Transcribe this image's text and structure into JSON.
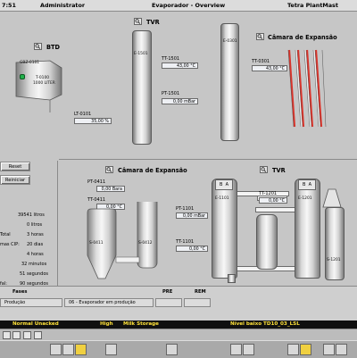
{
  "titlebar": {
    "time": "7:51",
    "user": "Administrator",
    "screen": "Evaporador - Overview",
    "app": "Tetra PlantMast"
  },
  "btd": {
    "title": "BTD",
    "tank_id": "GBZ-0101",
    "tank_label": "T-0100",
    "tank_volume": "1000 LITER",
    "lt_tag": "LT-0101",
    "lt_value": "35,00 %"
  },
  "tvr_top": {
    "title": "TVR",
    "vessel_label": "E-1501",
    "tt_tag": "TT-1501",
    "tt_value": "43,00 °C",
    "pt_tag": "PT-1501",
    "pt_value": "0,00 mBar"
  },
  "flash_top": {
    "title": "Câmara de Expansão",
    "vessel_label": "E-0301",
    "tt_tag": "TT-0301",
    "tt_value": "43,00 °C"
  },
  "side": {
    "reset_label": "Reset",
    "reiniciar_label": "Reiniciar",
    "stats": [
      {
        "label": "",
        "value": "39541 litros"
      },
      {
        "label": "",
        "value": "0 litros"
      },
      {
        "label": "Total",
        "value": "3 horas"
      },
      {
        "label": "mas CIP:",
        "value": "20 dias"
      },
      {
        "label": "",
        "value": "4 horas"
      },
      {
        "label": "",
        "value": "32 minutos"
      },
      {
        "label": "",
        "value": "51 segundos"
      },
      {
        "label": "fal:",
        "value": "90 segundos"
      }
    ]
  },
  "flash_bottom": {
    "title": "Câmara de Expansão",
    "pt_tag": "PT-0411",
    "pt_value": "0,00 Bara",
    "tt_tag": "TT-0411",
    "tt_value": "0,00 °C",
    "vessel_left": "S-0411",
    "vessel_right": "S-0412"
  },
  "tvr_bottom": {
    "title": "TVR",
    "pt_tag": "PT-1101",
    "pt_value": "0,00 mBar",
    "tt_tag": "TT-1101",
    "tt_value": "0,00 °C",
    "tt2_tag": "TT-1201",
    "tt2_value": "0,00 °C",
    "vessel1": "E-1101",
    "vessel2": "E-1201",
    "vessel3": "S-1201",
    "b_label": "B",
    "a_label": "A"
  },
  "bottom_panel": {
    "fases_label": "Fases",
    "pre_label": "PRE",
    "rem_label": "REM",
    "producao": "Produção",
    "phase_value": "06 - Evaporador em produção"
  },
  "alarm": {
    "status": "Normal Unacked",
    "priority": "High",
    "area": "Milk Storage",
    "message": "Nível baixo TD10_03_LSL"
  },
  "colors": {
    "alarm_bg": "#101010",
    "alarm_text": "#ffe23a",
    "status_led": "#22b14c",
    "flash_red": "#d9342b"
  }
}
